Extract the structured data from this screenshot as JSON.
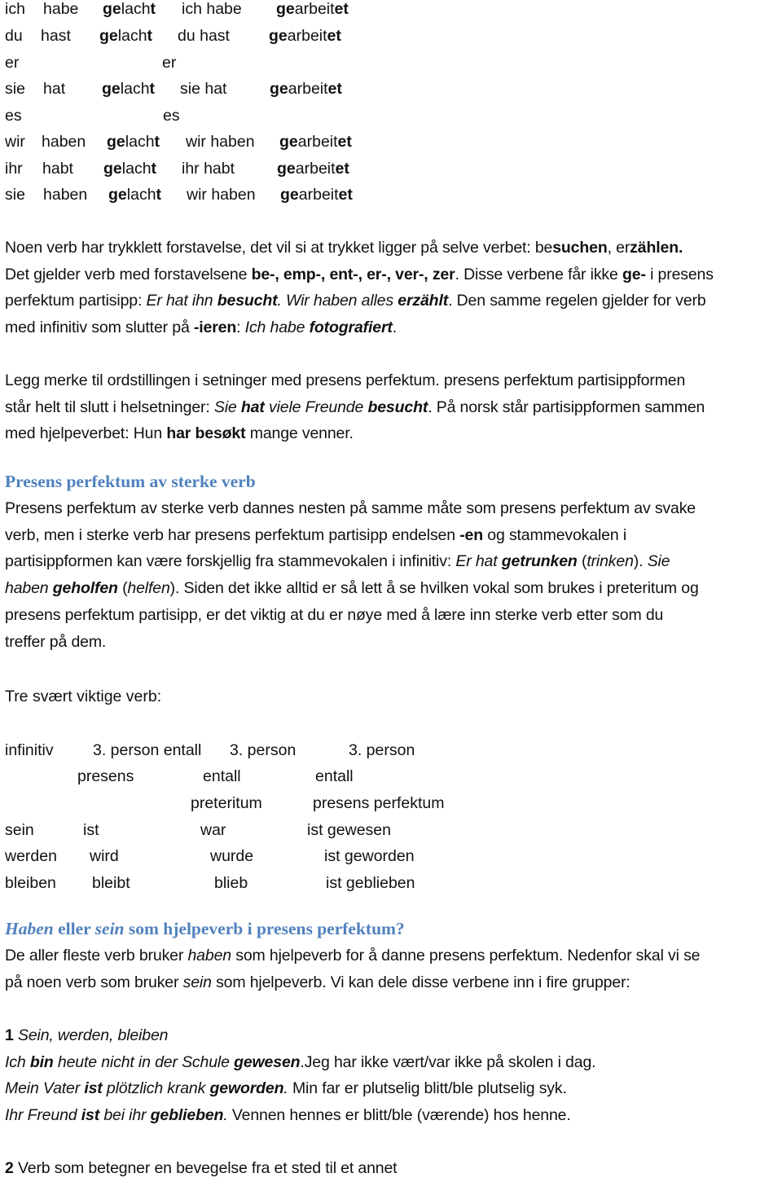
{
  "theme": {
    "heading_color": "#4F81BD",
    "text_color": "#111111"
  },
  "conjugation": {
    "rows": [
      {
        "pronoun": "ich",
        "aux": "habe",
        "p1_pre": "ge",
        "p1_mid": "lach",
        "p1_suf": "t",
        "pair": "ich habe",
        "p2_pre": "ge",
        "p2_mid": "arbeit",
        "p2_suf": "et"
      },
      {
        "pronoun": "du",
        "aux": "hast",
        "p1_pre": "ge",
        "p1_mid": "lach",
        "p1_suf": "t",
        "pair": "du hast",
        "p2_pre": "ge",
        "p2_mid": "arbeit",
        "p2_suf": "et"
      },
      {
        "pronoun": "er",
        "aux": "",
        "p1_pre": "",
        "p1_mid": "",
        "p1_suf": "",
        "pair": "er",
        "p2_pre": "",
        "p2_mid": "",
        "p2_suf": ""
      },
      {
        "pronoun": "sie",
        "aux": "hat",
        "p1_pre": "ge",
        "p1_mid": "lach",
        "p1_suf": "t",
        "pair": "sie hat",
        "p2_pre": "ge",
        "p2_mid": "arbeit",
        "p2_suf": "et"
      },
      {
        "pronoun": "es",
        "aux": "",
        "p1_pre": "",
        "p1_mid": "",
        "p1_suf": "",
        "pair": "es",
        "p2_pre": "",
        "p2_mid": "",
        "p2_suf": ""
      },
      {
        "pronoun": "wir",
        "aux": "haben",
        "p1_pre": "ge",
        "p1_mid": "lach",
        "p1_suf": "t",
        "pair": "wir haben",
        "p2_pre": "ge",
        "p2_mid": "arbeit",
        "p2_suf": "et"
      },
      {
        "pronoun": "ihr",
        "aux": "habt",
        "p1_pre": "ge",
        "p1_mid": "lach",
        "p1_suf": "t",
        "pair": "ihr habt",
        "p2_pre": "ge",
        "p2_mid": "arbeit",
        "p2_suf": "et"
      },
      {
        "pronoun": "sie",
        "aux": "haben",
        "p1_pre": "ge",
        "p1_mid": "lach",
        "p1_suf": "t",
        "pair": "wir haben",
        "p2_pre": "ge",
        "p2_mid": "arbeit",
        "p2_suf": "et"
      }
    ]
  },
  "para1": {
    "l1": {
      "a": "Noen verb har trykklett forstavelse, det vil si at trykket ligger på selve verbet: be",
      "b": "suchen",
      "c": ", er",
      "d": "zählen."
    },
    "l2": {
      "a": "Det gjelder verb med forstavelsene ",
      "b": "be-, emp-, ent-, er-, ver-, zer",
      "c": ". Disse verbene får ikke ",
      "d": "ge-",
      "e": " i presens"
    },
    "l3": {
      "a": "perfektum partisipp: ",
      "b": "Er hat ihn ",
      "c": "besucht",
      "d": ". Wir haben alles ",
      "e": "erzählt",
      "f": ". Den samme regelen gjelder for verb"
    },
    "l4": {
      "a": "med infinitiv som slutter på ",
      "b": "-ieren",
      "c": ": ",
      "d": "Ich habe ",
      "e": "fotografiert",
      "f": "."
    }
  },
  "para2": {
    "l1": "Legg merke til ordstillingen i setninger med presens perfektum. presens perfektum partisippformen",
    "l2": {
      "a": "står helt til slutt i helsetninger: ",
      "b": "Sie ",
      "c": "hat",
      "d": " viele Freunde ",
      "e": "besucht",
      "f": ". På norsk står partisippformen sammen"
    },
    "l3": {
      "a": "med hjelpeverbet: Hun ",
      "b": "har besøkt",
      "c": " mange venner."
    }
  },
  "heading1": "Presens perfektum av sterke verb",
  "para3": {
    "l1": "Presens perfektum av sterke verb dannes nesten på samme måte som presens perfektum av svake",
    "l2": {
      "a": "verb, men i sterke verb har presens perfektum partisipp endelsen ",
      "b": "-en",
      "c": " og stammevokalen i"
    },
    "l3": {
      "a": "partisippformen kan være forskjellig fra stammevokalen i infinitiv: ",
      "b": "Er hat ",
      "c": "getrunken",
      "d": " (",
      "e": "trinken",
      "f": "). ",
      "g": "Sie"
    },
    "l4": {
      "a": "haben ",
      "b": "geholfen",
      "c": " (",
      "d": "helfen",
      "e": "). Siden det ikke alltid er så lett å se hvilken vokal som brukes i preteritum og"
    },
    "l5": "presens perfektum partisipp, er det viktig at du er nøye med å lære inn sterke verb etter som du",
    "l6": "treffer på dem."
  },
  "intro_verbs": "Tre svært viktige verb:",
  "verb_table": {
    "headers": {
      "c1": "infinitiv",
      "c2": "3. person entall",
      "c2b": "presens",
      "c3": "3. person",
      "c3b": "entall",
      "c3c": "preteritum",
      "c4": "3. person",
      "c4b": "entall",
      "c4c": "presens perfektum"
    },
    "rows": [
      {
        "inf": "sein",
        "pres": "ist",
        "pret": "war",
        "perf": "ist gewesen"
      },
      {
        "inf": "werden",
        "pres": "wird",
        "pret": "wurde",
        "perf": "ist geworden"
      },
      {
        "inf": "bleiben",
        "pres": "bleibt",
        "pret": "blieb",
        "perf": "ist geblieben"
      }
    ]
  },
  "heading2": {
    "a": "Haben",
    "b": " eller ",
    "c": "sein",
    "d": " som hjelpeverb i presens perfektum?"
  },
  "para4": {
    "l1": {
      "a": "De aller fleste verb bruker ",
      "b": "haben",
      "c": " som hjelpeverb for å danne presens perfektum. Nedenfor skal vi se"
    },
    "l2": {
      "a": "på noen verb som bruker ",
      "b": "sein",
      "c": " som hjelpeverb. Vi kan dele disse verbene inn i fire grupper:"
    }
  },
  "group1": {
    "num": "1",
    "title": " Sein, werden, bleiben",
    "ex1": {
      "a": "Ich ",
      "b": "bin",
      "c": " heute nicht in der Schule ",
      "d": "gewesen",
      "e": ".",
      "f": "Jeg har ikke vært/var ikke på skolen i dag."
    },
    "ex2": {
      "a": "Mein Vater ",
      "b": "ist",
      "c": " plötzlich krank ",
      "d": "geworden",
      "e": ".",
      "f": " Min far er plutselig blitt/ble plutselig syk."
    },
    "ex3": {
      "a": "Ihr Freund ",
      "b": "ist",
      "c": " bei ihr ",
      "d": "geblieben",
      "e": ".",
      "f": " Vennen hennes er blitt/ble (værende) hos henne."
    }
  },
  "group2": {
    "num": "2",
    "title": " Verb som betegner en bevegelse fra et sted til et annet"
  }
}
